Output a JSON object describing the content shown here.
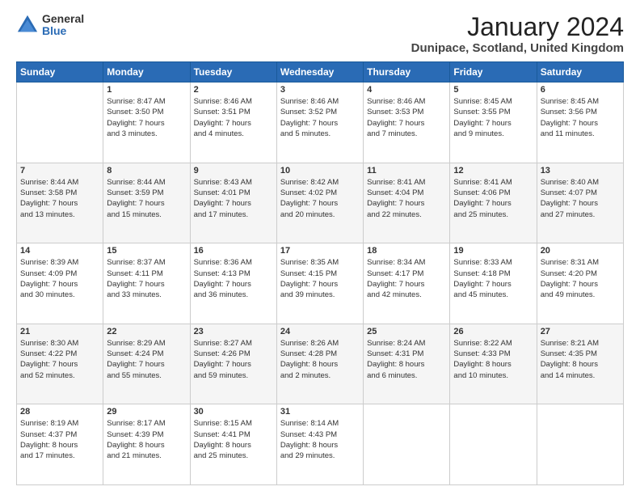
{
  "header": {
    "logo_general": "General",
    "logo_blue": "Blue",
    "title": "January 2024",
    "subtitle": "Dunipace, Scotland, United Kingdom"
  },
  "calendar": {
    "days_of_week": [
      "Sunday",
      "Monday",
      "Tuesday",
      "Wednesday",
      "Thursday",
      "Friday",
      "Saturday"
    ],
    "weeks": [
      [
        {
          "day": "",
          "info": ""
        },
        {
          "day": "1",
          "info": "Sunrise: 8:47 AM\nSunset: 3:50 PM\nDaylight: 7 hours\nand 3 minutes."
        },
        {
          "day": "2",
          "info": "Sunrise: 8:46 AM\nSunset: 3:51 PM\nDaylight: 7 hours\nand 4 minutes."
        },
        {
          "day": "3",
          "info": "Sunrise: 8:46 AM\nSunset: 3:52 PM\nDaylight: 7 hours\nand 5 minutes."
        },
        {
          "day": "4",
          "info": "Sunrise: 8:46 AM\nSunset: 3:53 PM\nDaylight: 7 hours\nand 7 minutes."
        },
        {
          "day": "5",
          "info": "Sunrise: 8:45 AM\nSunset: 3:55 PM\nDaylight: 7 hours\nand 9 minutes."
        },
        {
          "day": "6",
          "info": "Sunrise: 8:45 AM\nSunset: 3:56 PM\nDaylight: 7 hours\nand 11 minutes."
        }
      ],
      [
        {
          "day": "7",
          "info": "Sunrise: 8:44 AM\nSunset: 3:58 PM\nDaylight: 7 hours\nand 13 minutes."
        },
        {
          "day": "8",
          "info": "Sunrise: 8:44 AM\nSunset: 3:59 PM\nDaylight: 7 hours\nand 15 minutes."
        },
        {
          "day": "9",
          "info": "Sunrise: 8:43 AM\nSunset: 4:01 PM\nDaylight: 7 hours\nand 17 minutes."
        },
        {
          "day": "10",
          "info": "Sunrise: 8:42 AM\nSunset: 4:02 PM\nDaylight: 7 hours\nand 20 minutes."
        },
        {
          "day": "11",
          "info": "Sunrise: 8:41 AM\nSunset: 4:04 PM\nDaylight: 7 hours\nand 22 minutes."
        },
        {
          "day": "12",
          "info": "Sunrise: 8:41 AM\nSunset: 4:06 PM\nDaylight: 7 hours\nand 25 minutes."
        },
        {
          "day": "13",
          "info": "Sunrise: 8:40 AM\nSunset: 4:07 PM\nDaylight: 7 hours\nand 27 minutes."
        }
      ],
      [
        {
          "day": "14",
          "info": "Sunrise: 8:39 AM\nSunset: 4:09 PM\nDaylight: 7 hours\nand 30 minutes."
        },
        {
          "day": "15",
          "info": "Sunrise: 8:37 AM\nSunset: 4:11 PM\nDaylight: 7 hours\nand 33 minutes."
        },
        {
          "day": "16",
          "info": "Sunrise: 8:36 AM\nSunset: 4:13 PM\nDaylight: 7 hours\nand 36 minutes."
        },
        {
          "day": "17",
          "info": "Sunrise: 8:35 AM\nSunset: 4:15 PM\nDaylight: 7 hours\nand 39 minutes."
        },
        {
          "day": "18",
          "info": "Sunrise: 8:34 AM\nSunset: 4:17 PM\nDaylight: 7 hours\nand 42 minutes."
        },
        {
          "day": "19",
          "info": "Sunrise: 8:33 AM\nSunset: 4:18 PM\nDaylight: 7 hours\nand 45 minutes."
        },
        {
          "day": "20",
          "info": "Sunrise: 8:31 AM\nSunset: 4:20 PM\nDaylight: 7 hours\nand 49 minutes."
        }
      ],
      [
        {
          "day": "21",
          "info": "Sunrise: 8:30 AM\nSunset: 4:22 PM\nDaylight: 7 hours\nand 52 minutes."
        },
        {
          "day": "22",
          "info": "Sunrise: 8:29 AM\nSunset: 4:24 PM\nDaylight: 7 hours\nand 55 minutes."
        },
        {
          "day": "23",
          "info": "Sunrise: 8:27 AM\nSunset: 4:26 PM\nDaylight: 7 hours\nand 59 minutes."
        },
        {
          "day": "24",
          "info": "Sunrise: 8:26 AM\nSunset: 4:28 PM\nDaylight: 8 hours\nand 2 minutes."
        },
        {
          "day": "25",
          "info": "Sunrise: 8:24 AM\nSunset: 4:31 PM\nDaylight: 8 hours\nand 6 minutes."
        },
        {
          "day": "26",
          "info": "Sunrise: 8:22 AM\nSunset: 4:33 PM\nDaylight: 8 hours\nand 10 minutes."
        },
        {
          "day": "27",
          "info": "Sunrise: 8:21 AM\nSunset: 4:35 PM\nDaylight: 8 hours\nand 14 minutes."
        }
      ],
      [
        {
          "day": "28",
          "info": "Sunrise: 8:19 AM\nSunset: 4:37 PM\nDaylight: 8 hours\nand 17 minutes."
        },
        {
          "day": "29",
          "info": "Sunrise: 8:17 AM\nSunset: 4:39 PM\nDaylight: 8 hours\nand 21 minutes."
        },
        {
          "day": "30",
          "info": "Sunrise: 8:15 AM\nSunset: 4:41 PM\nDaylight: 8 hours\nand 25 minutes."
        },
        {
          "day": "31",
          "info": "Sunrise: 8:14 AM\nSunset: 4:43 PM\nDaylight: 8 hours\nand 29 minutes."
        },
        {
          "day": "",
          "info": ""
        },
        {
          "day": "",
          "info": ""
        },
        {
          "day": "",
          "info": ""
        }
      ]
    ]
  }
}
